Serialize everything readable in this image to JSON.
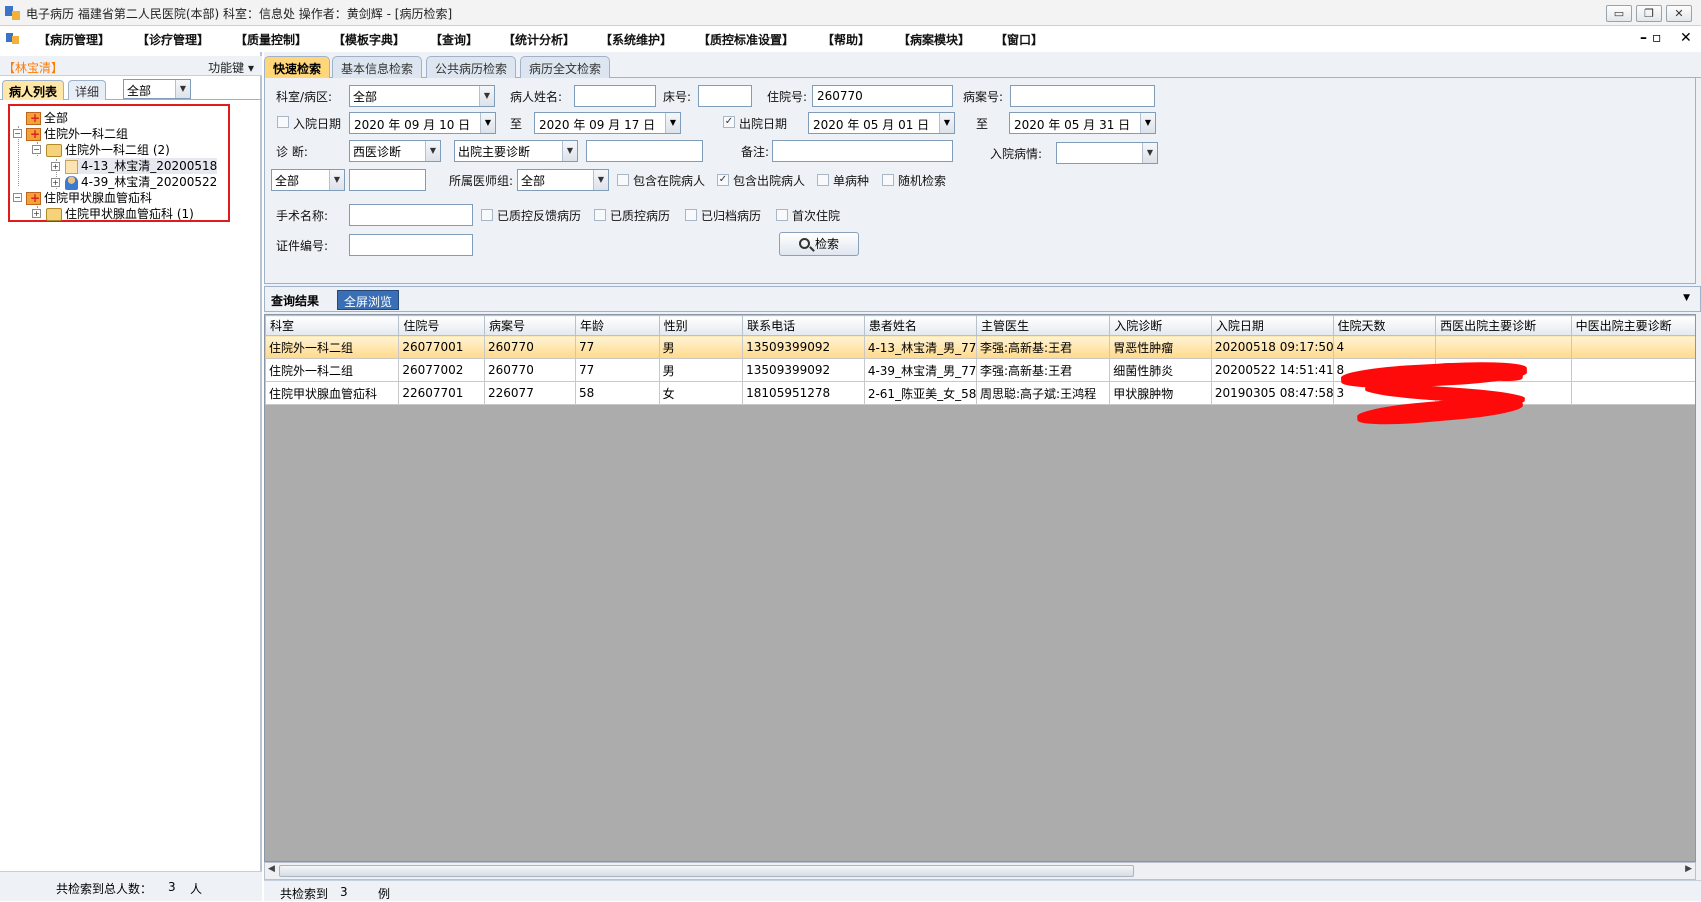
{
  "window": {
    "title": "电子病历  福建省第二人民医院(本部)  科室：信息处  操作者：黄剑辉 - [病历检索]",
    "buttons": [
      "minimize-icon",
      "restore-icon",
      "close-icon"
    ]
  },
  "menu": {
    "items": [
      "【病历管理】",
      "【诊疗管理】",
      "【质量控制】",
      "【模板字典】",
      "【查询】",
      "【统计分析】",
      "【系统维护】",
      "【质控标准设置】",
      "【帮助】",
      "【病案模块】",
      "【窗口】"
    ],
    "mdi_restore": "–  ▫",
    "mdi_close": "✕"
  },
  "left": {
    "patient": "【林宝清】",
    "function_key": "功能键",
    "tabs": [
      "病人列表",
      "详细"
    ],
    "filter": "全部",
    "tree": [
      "全部",
      "住院外一科二组",
      "住院外一科二组 (2)",
      "4-13_林宝清_20200518",
      "4-39_林宝清_20200522",
      "住院甲状腺血管疝科",
      "住院甲状腺血管疝科 (1)"
    ],
    "footer_label": "共检索到总人数：",
    "footer_count": "3",
    "footer_unit": "人"
  },
  "tabs": [
    "快速检索",
    "基本信息检索",
    "公共病历检索",
    "病历全文检索"
  ],
  "form": {
    "dept_label": "科室/病区:",
    "dept_value": "全部",
    "name_label": "病人姓名:",
    "name_value": "",
    "bed_label": "床号:",
    "bed_value": "",
    "inpatient_no_label": "住院号:",
    "inpatient_no_value": "260770",
    "case_no_label": "病案号:",
    "case_no_value": "",
    "admit_date_label": "入院日期",
    "admit_from": "2020 年 09 月 10 日",
    "to_label": "至",
    "admit_to": "2020 年 09 月 17 日",
    "discharge_date_label": "出院日期",
    "discharge_from": "2020 年 05 月 01 日",
    "to_label2": "至",
    "discharge_to": "2020 年 05 月 31 日",
    "diag_label": "诊    断:",
    "diag_type": "西医诊断",
    "diag_kind": "出院主要诊断",
    "diag_value": "",
    "remark_label": "备注:",
    "remark_value": "",
    "admit_cond_label": "入院病情:",
    "admit_cond_value": "",
    "scope_value": "全部",
    "scope_text": "",
    "doctor_group_label": "所属医师组:",
    "doctor_group_value": "全部",
    "chk_inhospital": "包含在院病人",
    "chk_discharged": "包含出院病人",
    "chk_single": "单病种",
    "chk_random": "随机检索",
    "surgery_label": "手术名称:",
    "surgery_value": "",
    "chk_qc_feedback": "已质控反馈病历",
    "chk_qc": "已质控病历",
    "chk_archived": "已归档病历",
    "chk_first": "首次住院",
    "cert_label": "证件编号:",
    "cert_value": "",
    "search_button": "检索"
  },
  "results": {
    "title": "查询结果",
    "fullscreen": "全屏浏览",
    "columns": [
      "科室",
      "住院号",
      "病案号",
      "年龄",
      "性别",
      "联系电话",
      "患者姓名",
      "主管医生",
      "入院诊断",
      "入院日期",
      "住院天数",
      "西医出院主要诊断",
      "中医出院主要诊断"
    ],
    "rows": [
      [
        "住院外一科二组",
        "26077001",
        "260770",
        "77",
        "男",
        "13509399092",
        "4-13_林宝清_男_77",
        "李强:高新基:王君",
        "胃恶性肿瘤",
        "20200518 09:17:50",
        "4",
        "",
        ""
      ],
      [
        "住院外一科二组",
        "26077002",
        "260770",
        "77",
        "男",
        "13509399092",
        "4-39_林宝清_男_77",
        "李强:高新基:王君",
        "细菌性肺炎",
        "20200522 14:51:41",
        "8",
        "",
        ""
      ],
      [
        "住院甲状腺血管疝科",
        "22607701",
        "226077",
        "58",
        "女",
        "18105951278",
        "2-61_陈亚美_女_58",
        "周思聪:高子斌:王鸿程",
        "甲状腺肿物",
        "20190305 08:47:58",
        "3",
        "",
        ""
      ]
    ]
  },
  "status": {
    "label": "共检索到",
    "count": "3",
    "unit": "例"
  },
  "colors": {
    "selected_row": "#ffd98a",
    "tab_active": "#ffd77a",
    "redaction": "#ff0a0a",
    "tree_highlight_border": "#e01b1b"
  }
}
